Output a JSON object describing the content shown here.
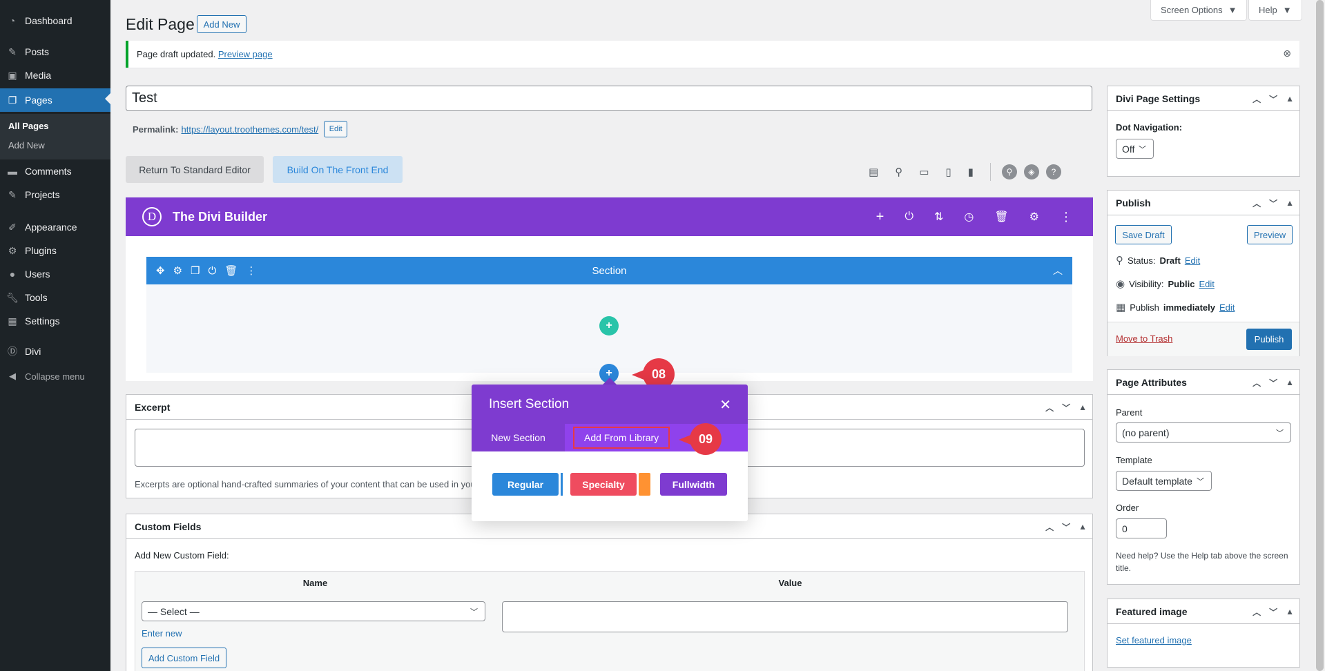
{
  "sidebar": {
    "items": [
      {
        "label": "Dashboard",
        "icon": "dashboard-icon"
      },
      {
        "label": "Posts",
        "icon": "pin-icon"
      },
      {
        "label": "Media",
        "icon": "media-icon"
      },
      {
        "label": "Pages",
        "icon": "pages-icon"
      },
      {
        "label": "Comments",
        "icon": "comment-icon"
      },
      {
        "label": "Projects",
        "icon": "pin-icon"
      },
      {
        "label": "Appearance",
        "icon": "brush-icon"
      },
      {
        "label": "Plugins",
        "icon": "plugin-icon"
      },
      {
        "label": "Users",
        "icon": "user-icon"
      },
      {
        "label": "Tools",
        "icon": "wrench-icon"
      },
      {
        "label": "Settings",
        "icon": "settings-icon"
      },
      {
        "label": "Divi",
        "icon": "divi-icon"
      }
    ],
    "submenu": [
      "All Pages",
      "Add New"
    ],
    "collapse": "Collapse menu"
  },
  "topbar": {
    "screen_options": "Screen Options",
    "help": "Help"
  },
  "header": {
    "title": "Edit Page",
    "add_new": "Add New"
  },
  "notice": {
    "text": "Page draft updated.",
    "link": "Preview page"
  },
  "post": {
    "title": "Test",
    "permalink_label": "Permalink:",
    "permalink_url": "https://layout.troothemes.com/test/",
    "edit": "Edit"
  },
  "editor_buttons": {
    "standard": "Return To Standard Editor",
    "frontend": "Build On The Front End"
  },
  "divi": {
    "title": "The Divi Builder",
    "logo": "D",
    "section_label": "Section"
  },
  "modal": {
    "title": "Insert Section",
    "tabs": [
      "New Section",
      "Add From Library"
    ],
    "buttons": [
      {
        "label": "Regular",
        "color": "#2b87da"
      },
      {
        "label": "Specialty",
        "color": "#ef4c5f"
      },
      {
        "label": "Fullwidth",
        "color": "#7e3bd0"
      }
    ]
  },
  "callouts": {
    "step1": "08",
    "step2": "09"
  },
  "excerpt": {
    "title": "Excerpt",
    "help": "Excerpts are optional hand-crafted summaries of your content that can be used in you"
  },
  "custom_fields": {
    "title": "Custom Fields",
    "add_new_label": "Add New Custom Field:",
    "col_name": "Name",
    "col_value": "Value",
    "select": "— Select —",
    "enter_new": "Enter new",
    "add_button": "Add Custom Field"
  },
  "divi_settings": {
    "title": "Divi Page Settings",
    "dot_label": "Dot Navigation:",
    "dot_value": "Off"
  },
  "publish": {
    "title": "Publish",
    "save_draft": "Save Draft",
    "preview": "Preview",
    "status_label": "Status:",
    "status_value": "Draft",
    "visibility_label": "Visibility:",
    "visibility_value": "Public",
    "publish_label": "Publish",
    "publish_value": "immediately",
    "edit": "Edit",
    "trash": "Move to Trash",
    "publish_button": "Publish"
  },
  "attributes": {
    "title": "Page Attributes",
    "parent_label": "Parent",
    "parent_value": "(no parent)",
    "template_label": "Template",
    "template_value": "Default template",
    "order_label": "Order",
    "order_value": "0",
    "help": "Need help? Use the Help tab above the screen title."
  },
  "featured": {
    "title": "Featured image",
    "link": "Set featured image"
  },
  "colors": {
    "wp_blue": "#2271b1",
    "divi_purple": "#7e3bd0",
    "divi_blue": "#2b87da",
    "callout_red": "#e63946",
    "notice_green": "#00a32a"
  }
}
